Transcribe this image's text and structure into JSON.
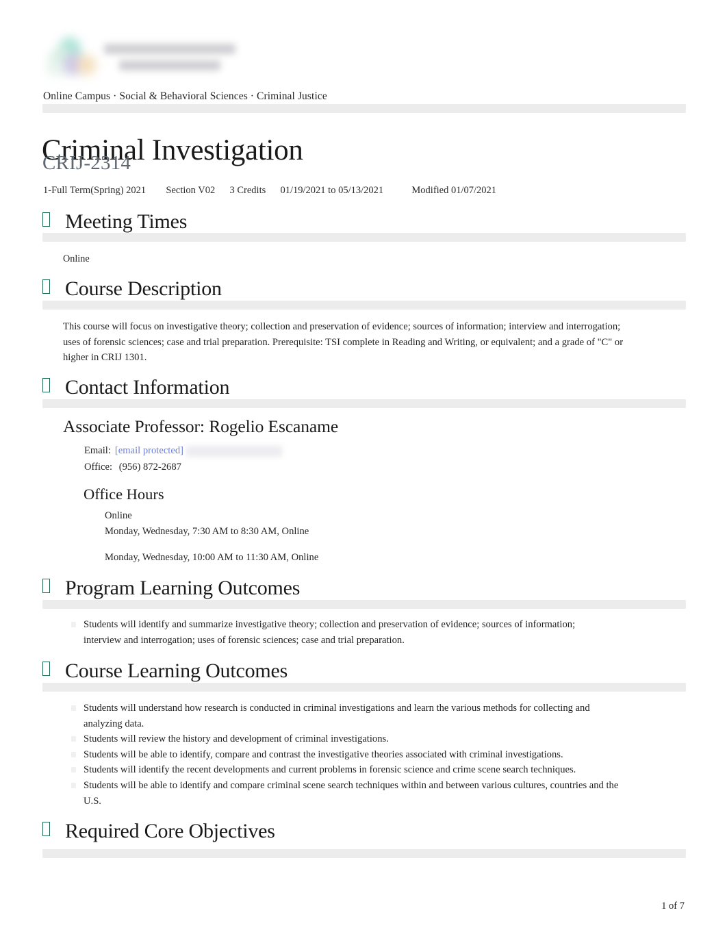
{
  "document": {
    "breadcrumb": "Online Campus · Social & Behavioral Sciences · Criminal Justice",
    "course_title": "Criminal Investigation",
    "course_code": "CRIJ-2314",
    "footer_page": "1 of 7",
    "accent_icon_color": "#1d6b4e",
    "link_color": "#6b7fd7",
    "divider_color": "#ececed"
  },
  "logo": {
    "mark_icon": "university-seal-icon",
    "wordmark_icon": "university-wordmark-icon",
    "state": "blurred"
  },
  "meta": {
    "term": "1-Full Term(Spring) 2021",
    "section": "Section V02",
    "credits": "3 Credits",
    "date_range": "01/19/2021 to 05/13/2021",
    "modified": "Modified 01/07/2021"
  },
  "sections": {
    "meeting_times": {
      "icon": "section-marker-icon",
      "title": "Meeting Times",
      "body": "Online"
    },
    "course_description": {
      "icon": "section-marker-icon",
      "title": "Course Description",
      "body": "This course will focus on investigative theory; collection and preservation of evidence; sources of information; interview and interrogation; uses of forensic sciences; case and trial preparation. Prerequisite: TSI complete in Reading and Writing, or equivalent; and a grade of \"C\" or higher in CRIJ 1301."
    },
    "contact_information": {
      "icon": "section-marker-icon",
      "title": "Contact Information",
      "instructor": "Associate Professor: Rogelio Escaname",
      "email_label": "Email:",
      "email_value": "[email protected]",
      "office_label": "Office:",
      "office_value": "(956) 872-2687",
      "office_hours_title": "Office Hours",
      "office_hours": [
        "Online",
        "Monday, Wednesday, 7:30 AM to 8:30 AM, Online",
        "Monday, Wednesday, 10:00 AM to 11:30 AM, Online"
      ]
    },
    "program_learning_outcomes": {
      "icon": "section-marker-icon",
      "title": "Program Learning Outcomes",
      "items": [
        "Students will identify and summarize investigative theory; collection and preservation of evidence; sources of information; interview and interrogation; uses of forensic sciences; case and trial preparation."
      ]
    },
    "course_learning_outcomes": {
      "icon": "section-marker-icon",
      "title": "Course Learning Outcomes",
      "items": [
        "Students will understand how research is conducted in criminal investigations and learn the various methods for collecting and analyzing data.",
        "Students will review the history and development of criminal investigations.",
        "Students will be able to identify, compare and contrast the investigative theories associated with criminal investigations.",
        "Students will identify the recent developments and current problems in forensic science and crime scene search techniques.",
        "Students will be able to identify and compare criminal scene search techniques within and between various cultures, countries and the U.S."
      ]
    },
    "required_core_objectives": {
      "icon": "section-marker-icon",
      "title": "Required Core Objectives"
    }
  }
}
